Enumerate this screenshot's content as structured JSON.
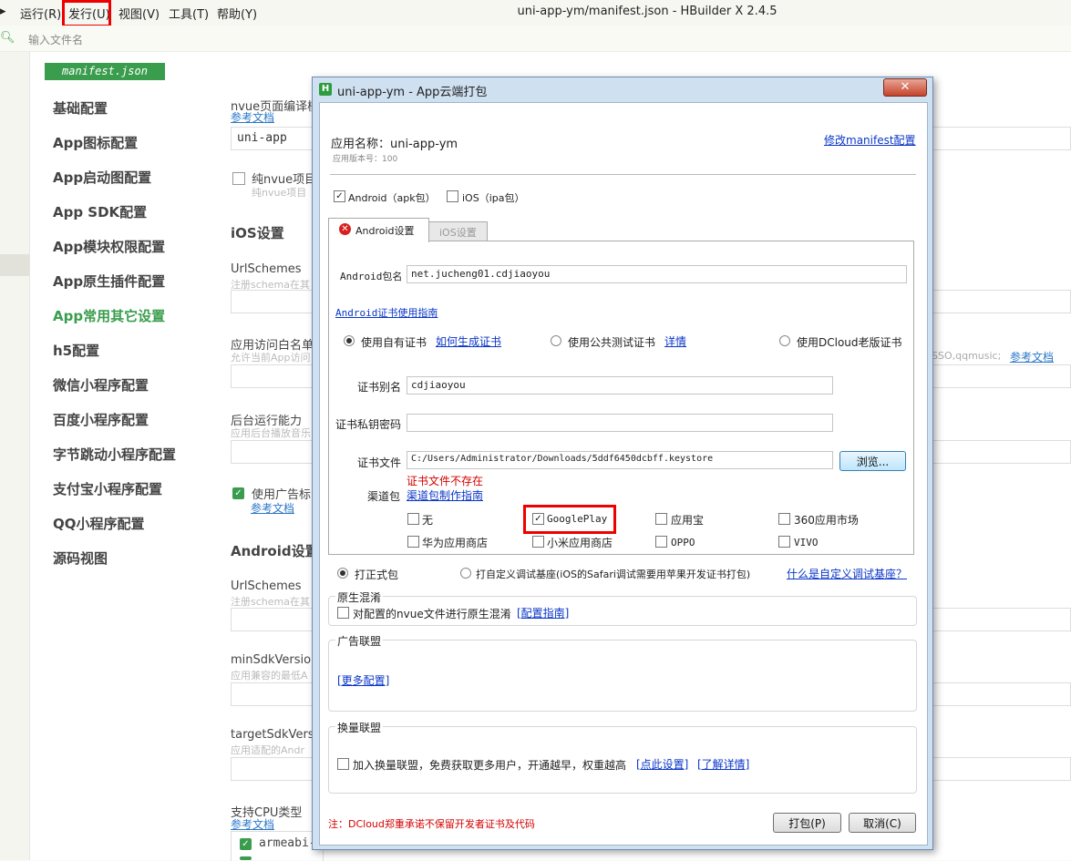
{
  "menu": {
    "items": [
      "运行(R)",
      "发行(U)",
      "视图(V)",
      "工具(T)",
      "帮助(Y)"
    ],
    "title": "uni-app-ym/manifest.json - HBuilder X 2.4.5"
  },
  "search": {
    "placeholder": "输入文件名"
  },
  "editor": {
    "tab": "manifest.json",
    "nav": [
      "基础配置",
      "App图标配置",
      "App启动图配置",
      "App SDK配置",
      "App模块权限配置",
      "App原生插件配置",
      "App常用其它设置",
      "h5配置",
      "微信小程序配置",
      "百度小程序配置",
      "字节跳动小程序配置",
      "支付宝小程序配置",
      "QQ小程序配置",
      "源码视图"
    ],
    "nvue_label": "nvue页面编译模",
    "ref_doc": "参考文档",
    "nvue_value": "uni-app",
    "pure_nvue": "纯nvue项目",
    "pure_nvue_help": "纯nvue项目",
    "ios_title": "iOS设置",
    "urlschemes": "UrlSchemes",
    "urlschemes_help": "注册schema在其",
    "whitelist": "应用访问白名单",
    "whitelist_help": "允许当前App访问",
    "whitelist_suffix": "SSO,qqmusic;",
    "background": "后台运行能力",
    "background_help": "应用后台播放音乐",
    "ad_flag": "使用广告标",
    "android_title": "Android设置",
    "a_urlschemes": "UrlSchemes",
    "a_urlschemes_help": "注册schema在其",
    "minsdk": "minSdkVersion",
    "minsdk_help": "应用兼容的最低A",
    "targetsdk": "targetSdkVers",
    "targetsdk_help": "应用适配的Andr",
    "cpu": "支持CPU类型",
    "cpu_item": "armeabi-"
  },
  "dialog": {
    "title": "uni-app-ym - App云端打包",
    "close": "✕",
    "app_name_label": "应用名称：uni-app-ym",
    "version": "应用版本号：100",
    "modify_link": "修改manifest配置",
    "android_pkg": "Android（apk包）",
    "ios_pkg": "iOS（ipa包）",
    "tab_android": "Android设置",
    "tab_ios": "iOS设置",
    "pkgname_label": "Android包名",
    "pkgname_value": "net.jucheng01.cdjiaoyou",
    "cert_guide": "Android证书使用指南",
    "cert_own": "使用自有证书",
    "cert_own_link": "如何生成证书",
    "cert_public": "使用公共测试证书",
    "cert_public_link": "详情",
    "cert_dcloud": "使用DCloud老版证书",
    "alias_label": "证书别名",
    "alias_value": "cdjiaoyou",
    "pwd_label": "证书私钥密码",
    "file_label": "证书文件",
    "file_value": "C:/Users/Administrator/Downloads/5ddf6450dcbff.keystore",
    "browse": "浏览...",
    "file_error": "证书文件不存在",
    "channel_label": "渠道包",
    "channel_link": "渠道包制作指南",
    "channels": [
      "无",
      "GooglePlay",
      "应用宝",
      "360应用市场",
      "华为应用商店",
      "小米应用商店",
      "OPPO",
      "VIVO"
    ],
    "formal": "打正式包",
    "custom": "打自定义调试基座(iOS的Safari调试需要用苹果开发证书打包)",
    "custom_link": "什么是自定义调试基座？",
    "obf_title": "原生混淆",
    "obf_check": "对配置的nvue文件进行原生混淆",
    "obf_link": "[配置指南]",
    "ad_title": "广告联盟",
    "ad_link": "[更多配置]",
    "swap_title": "换量联盟",
    "swap_check": "加入换量联盟，免费获取更多用户，开通越早，权重越高",
    "swap_link1": "[点此设置]",
    "swap_link2": "[了解详情]",
    "note": "注：DCloud郑重承诺不保留开发者证书及代码",
    "pack_btn": "打包(P)",
    "cancel_btn": "取消(C)"
  }
}
